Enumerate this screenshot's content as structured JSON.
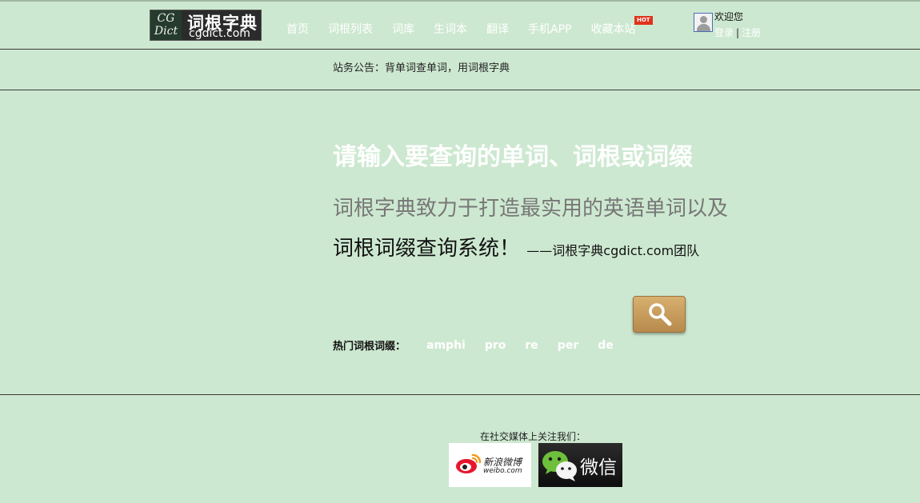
{
  "logo": {
    "cg_top": "CG",
    "cg_bottom": "Dict",
    "title_cn": "词根字典",
    "domain": "cgdict.com"
  },
  "nav": {
    "items": [
      "首页",
      "词根列表",
      "词库",
      "生词本",
      "翻译",
      "手机APP",
      "收藏本站"
    ],
    "hot_badge": "HOT"
  },
  "user": {
    "welcome": "欢迎您",
    "login": "登录",
    "separator": "|",
    "register": "注册"
  },
  "notice": {
    "text": "站务公告：背单词查单词，用词根字典"
  },
  "main": {
    "headline": "请输入要查询的单词、词根或词缀",
    "slogan_line1": "词根字典致力于打造最实用的英语单词以及",
    "slogan_line2": "词根词缀查询系统！",
    "signature": "——词根字典cgdict.com团队"
  },
  "hot_roots": {
    "label": "热门词根词缀：",
    "items": [
      "amphi",
      "pro",
      "re",
      "per",
      "de"
    ]
  },
  "footer": {
    "follow_text": "在社交媒体上关注我们：",
    "weibo_cn": "新浪微博",
    "weibo_en": "weibo.com",
    "wechat": "微信"
  },
  "icons": {
    "search": "magnifier-icon",
    "weibo": "weibo-logo-icon",
    "wechat": "wechat-logo-icon",
    "avatar": "user-avatar-icon"
  },
  "colors": {
    "background": "#cde8d0",
    "search_button": "#c89c5c",
    "hot_badge": "#e0321c"
  }
}
